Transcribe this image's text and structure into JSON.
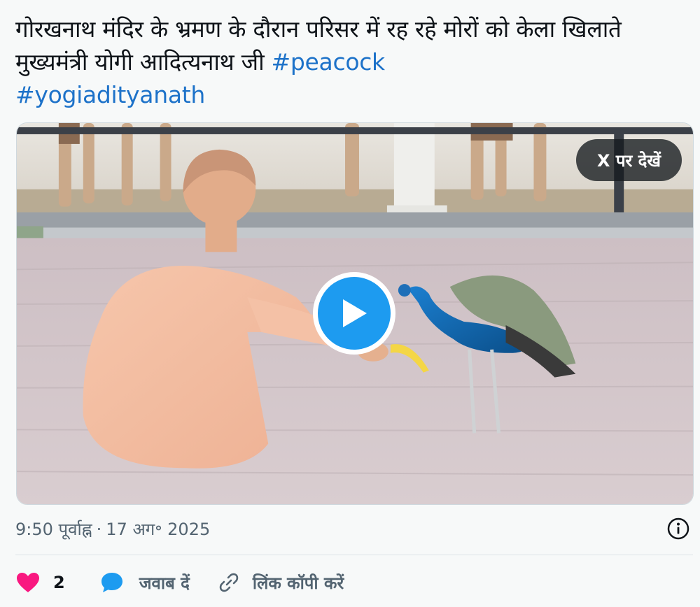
{
  "tweet": {
    "text_main": "गोरखनाथ मंदिर  के भ्रमण के दौरान परिसर में रह रहे मोरों को केला खिलाते मुख्यमंत्री योगी आदित्यनाथ जी ",
    "hashtags": [
      "#peacock",
      "#yogiadityanath"
    ]
  },
  "media": {
    "watch_on_x_label": "X पर देखें",
    "play_icon": "play-icon"
  },
  "meta": {
    "time": "9:50 पूर्वाह्न",
    "separator": "·",
    "date": "17 अग॰ 2025",
    "info_icon": "info-icon"
  },
  "actions": {
    "like_count": "2",
    "like_icon": "heart-icon",
    "reply_label": "जवाब दें",
    "reply_icon": "speech-bubble-icon",
    "copy_label": "लिंक कॉपी करें",
    "copy_icon": "link-icon"
  },
  "colors": {
    "hashtag": "#1d72c9",
    "heart": "#f91880",
    "reply": "#1d9bf0",
    "play": "#1d9bf0",
    "secondary_text": "#536471"
  }
}
